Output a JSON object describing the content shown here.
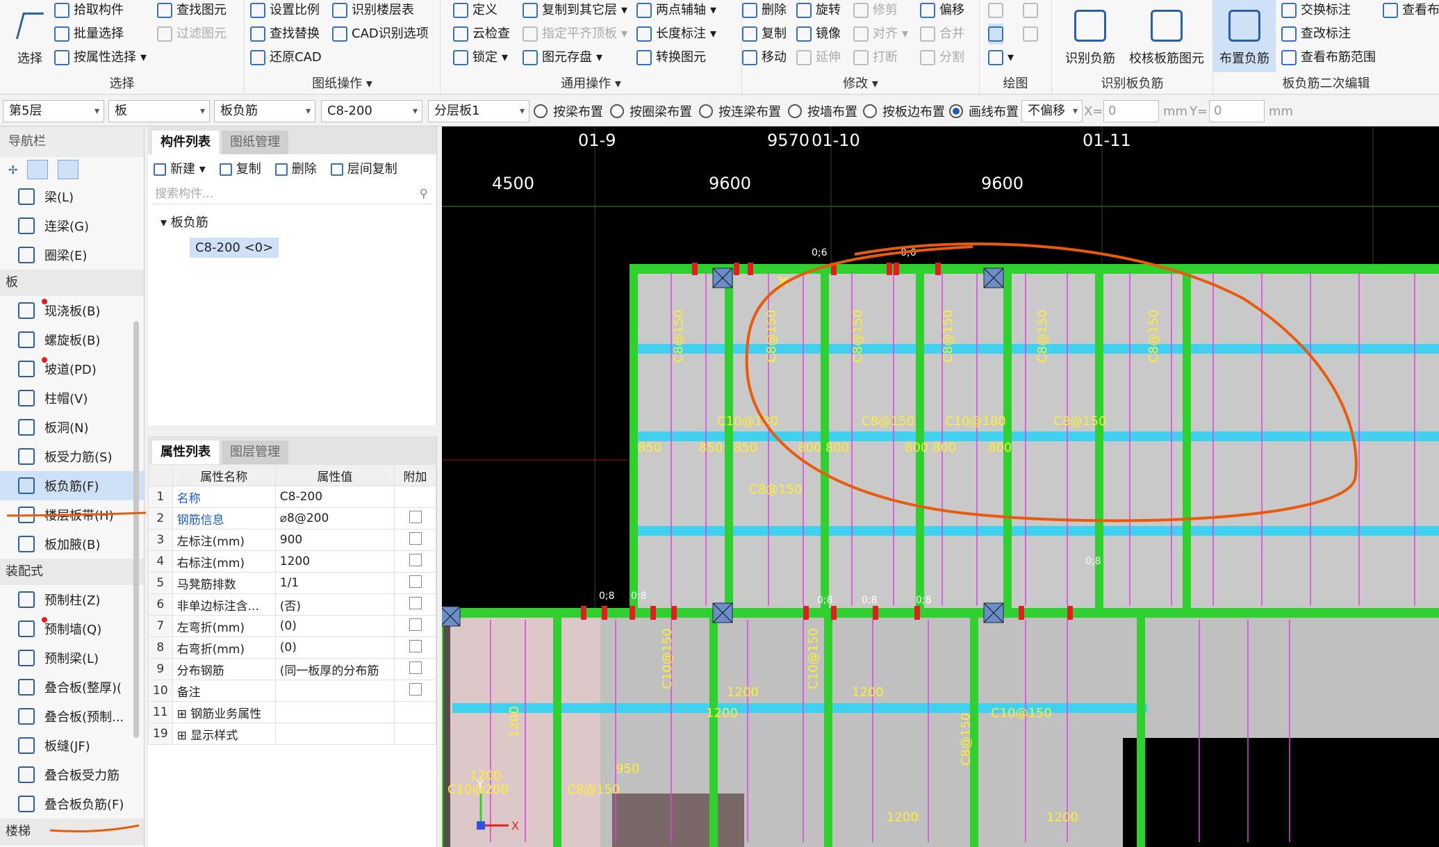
{
  "ribbon": {
    "select": {
      "label": "选择",
      "title": "选择",
      "pick": "拾取构件",
      "batch": "批量选择",
      "byprop": "按属性选择",
      "find": "查找图元",
      "filter": "过滤图元"
    },
    "drawing": {
      "title": "图纸操作",
      "scale": "设置比例",
      "replace": "查找替换",
      "restore": "还原CAD",
      "floor_table": "识别楼层表",
      "cad_options": "CAD识别选项"
    },
    "common": {
      "title": "通用操作",
      "define": "定义",
      "cloud": "云检查",
      "lock": "锁定",
      "copy_other": "复制到其它层",
      "align_top": "指定平齐顶板",
      "save": "图元存盘",
      "two_point": "两点辅轴",
      "length": "长度标注",
      "convert": "转换图元"
    },
    "modify": {
      "title": "修改",
      "delete": "删除",
      "copy": "复制",
      "move": "移动",
      "rotate": "旋转",
      "mirror": "镜像",
      "extend": "延伸",
      "trim": "修剪",
      "align": "对齐",
      "break": "打断",
      "offset": "偏移",
      "merge": "合并",
      "split": "分割"
    },
    "draw": {
      "title": "绘图"
    },
    "recognize": {
      "title": "识别板负筋",
      "recog": "识别负筋",
      "check": "校核板筋图元"
    },
    "edit": {
      "title": "板负筋二次编辑",
      "place": "布置负筋",
      "swap": "交换标注",
      "change": "查改标注",
      "view_range": "查看布筋范围",
      "view_more": "查看布"
    }
  },
  "options": {
    "floor": "第5层",
    "type": "板",
    "sub": "板负筋",
    "spec": "C8-200",
    "layer": "分层板1",
    "r1": "按梁布置",
    "r2": "按圈梁布置",
    "r3": "按连梁布置",
    "r4": "按墙布置",
    "r5": "按板边布置",
    "r6": "画线布置",
    "offset": "不偏移",
    "x_label": "X=",
    "x_val": "0",
    "x_unit": "mm",
    "y_label": "Y=",
    "y_val": "0",
    "y_unit": "mm"
  },
  "nav": {
    "title": "导航栏",
    "items_top": [
      "梁(L)",
      "连梁(G)",
      "圈梁(E)"
    ],
    "sec_board": "板",
    "board_items": [
      "现浇板(B)",
      "螺旋板(B)",
      "坡道(PD)",
      "柱帽(V)",
      "板洞(N)",
      "板受力筋(S)",
      "板负筋(F)",
      "楼层板带(H)",
      "板加腋(B)"
    ],
    "sec_prefab": "装配式",
    "prefab_items": [
      "预制柱(Z)",
      "预制墙(Q)",
      "预制梁(L)",
      "叠合板(整厚)(",
      "叠合板(预制...",
      "板缝(JF)",
      "叠合板受力筋",
      "叠合板负筋(F)"
    ],
    "sec_more": "楼梯"
  },
  "components": {
    "tab1": "构件列表",
    "tab2": "图纸管理",
    "new": "新建",
    "copy": "复制",
    "delete": "删除",
    "floor_copy": "层间复制",
    "search": "搜索构件...",
    "tree_root": "板负筋",
    "tree_item": "C8-200 <0>"
  },
  "properties": {
    "tab1": "属性列表",
    "tab2": "图层管理",
    "col_name": "属性名称",
    "col_value": "属性值",
    "col_extra": "附加",
    "rows": [
      {
        "n": "1",
        "name": "名称",
        "value": "C8-200"
      },
      {
        "n": "2",
        "name": "钢筋信息",
        "value": "⌀8@200"
      },
      {
        "n": "3",
        "name": "左标注(mm)",
        "value": "900"
      },
      {
        "n": "4",
        "name": "右标注(mm)",
        "value": "1200"
      },
      {
        "n": "5",
        "name": "马凳筋排数",
        "value": "1/1"
      },
      {
        "n": "6",
        "name": "非单边标注含...",
        "value": "(否)"
      },
      {
        "n": "7",
        "name": "左弯折(mm)",
        "value": "(0)"
      },
      {
        "n": "8",
        "name": "右弯折(mm)",
        "value": "(0)"
      },
      {
        "n": "9",
        "name": "分布钢筋",
        "value": "(同一板厚的分布筋"
      },
      {
        "n": "10",
        "name": "备注",
        "value": ""
      },
      {
        "n": "11",
        "name": "钢筋业务属性",
        "value": ""
      },
      {
        "n": "19",
        "name": "显示样式",
        "value": ""
      }
    ]
  },
  "cad": {
    "axes": [
      "01-9",
      "01-10",
      "01-11"
    ],
    "axis_extra": "9570",
    "dims": [
      "4500",
      "9600",
      "9600"
    ],
    "labels_cyan": [
      "C8@150",
      "C8@150",
      "C8@150",
      "C8@150",
      "C8@150",
      "C8@150"
    ],
    "labels_mid": [
      "C10@180",
      "C8@150",
      "C10@180",
      "C8@150"
    ],
    "dist": [
      "850",
      "850",
      "850",
      "800",
      "800",
      "800",
      "800",
      "800"
    ],
    "bottom_labels": [
      "C10@200",
      "1200",
      "1200",
      "C8@150",
      "950",
      "C10@150",
      "1200",
      "1200",
      "C10@150",
      "1200",
      "1200",
      "C8@150",
      "C10@150",
      "1200"
    ],
    "small": [
      "0;6",
      "0;6",
      "0;8",
      "0;8",
      "0;8",
      "0;8",
      "0;8",
      "0;8"
    ],
    "axis_y": "Y",
    "axis_x": "X"
  }
}
